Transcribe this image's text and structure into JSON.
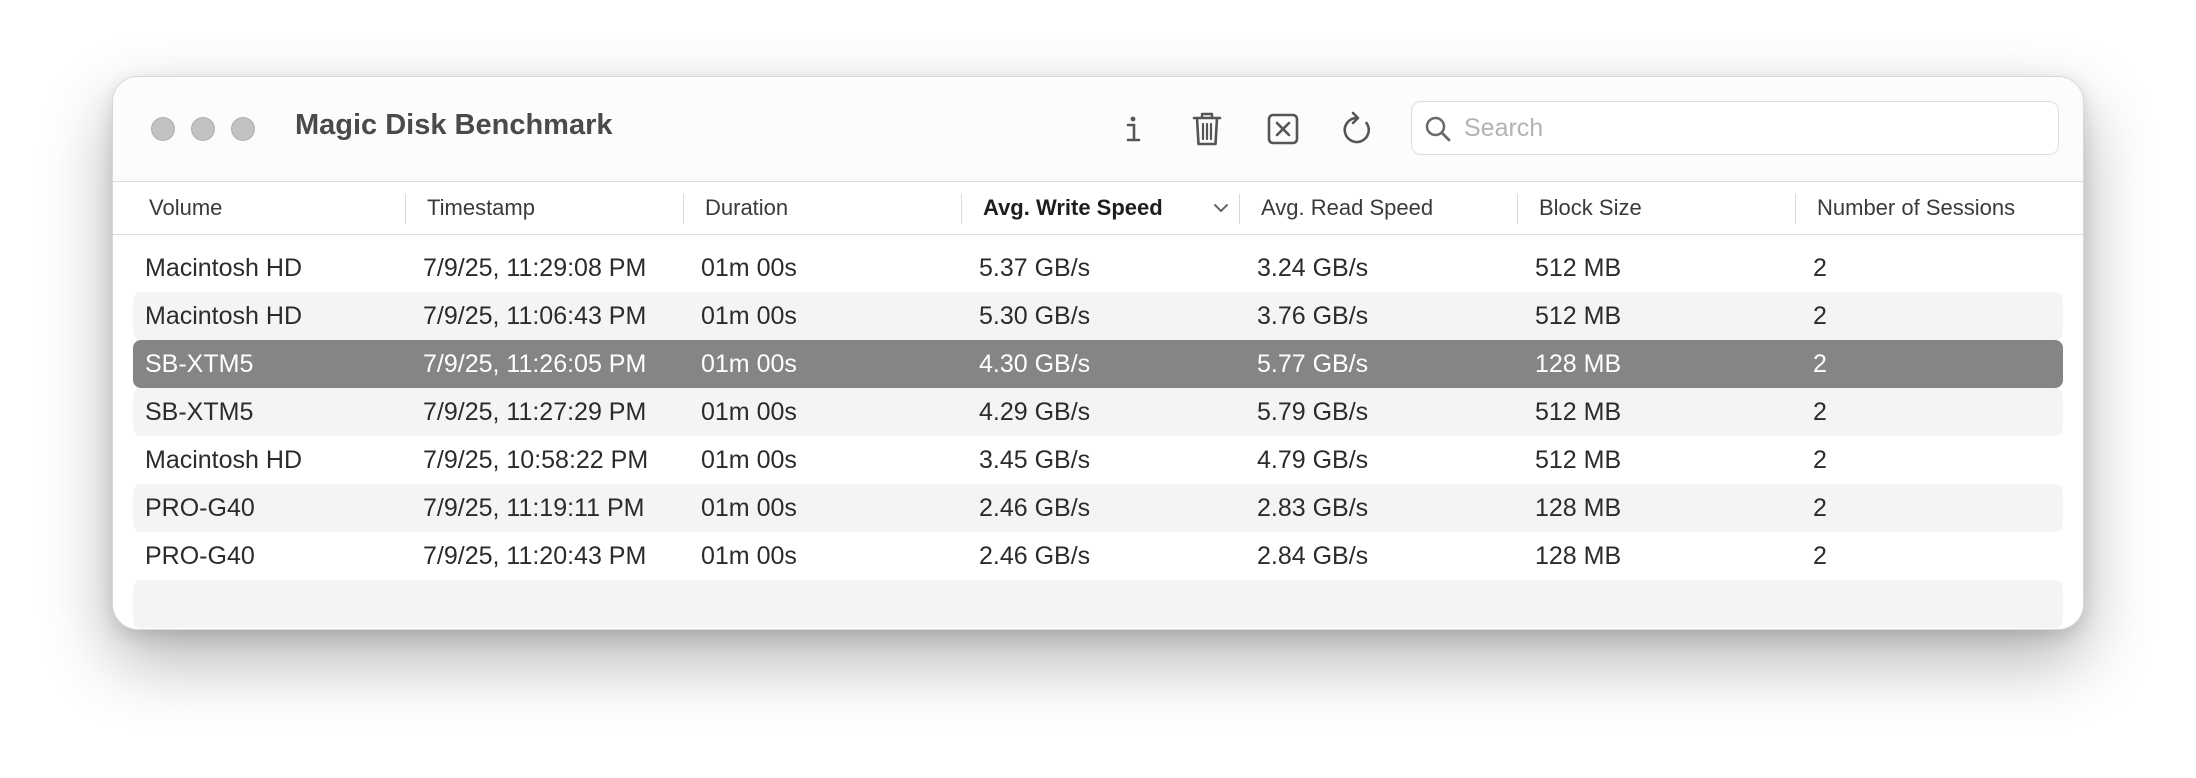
{
  "window": {
    "title": "Magic Disk Benchmark"
  },
  "toolbar": {
    "info_icon": "info-icon",
    "trash_icon": "trash-icon",
    "clear_icon": "x-square-icon",
    "refresh_icon": "refresh-icon"
  },
  "search": {
    "placeholder": "Search",
    "value": ""
  },
  "table": {
    "columns": [
      "Volume",
      "Timestamp",
      "Duration",
      "Avg. Write Speed",
      "Avg. Read Speed",
      "Block Size",
      "Number of Sessions"
    ],
    "sorted_column": "Avg. Write Speed",
    "sort_direction": "descending",
    "rows": [
      [
        "Macintosh HD",
        "7/9/25, 11:29:08 PM",
        "01m 00s",
        "5.37 GB/s",
        "3.24 GB/s",
        "512 MB",
        "2"
      ],
      [
        "Macintosh HD",
        "7/9/25, 11:06:43 PM",
        "01m 00s",
        "5.30 GB/s",
        "3.76 GB/s",
        "512 MB",
        "2"
      ],
      [
        "SB-XTM5",
        "7/9/25, 11:26:05 PM",
        "01m 00s",
        "4.30 GB/s",
        "5.77 GB/s",
        "128 MB",
        "2"
      ],
      [
        "SB-XTM5",
        "7/9/25, 11:27:29 PM",
        "01m 00s",
        "4.29 GB/s",
        "5.79 GB/s",
        "512 MB",
        "2"
      ],
      [
        "Macintosh HD",
        "7/9/25, 10:58:22 PM",
        "01m 00s",
        "3.45 GB/s",
        "4.79 GB/s",
        "512 MB",
        "2"
      ],
      [
        "PRO-G40",
        "7/9/25, 11:19:11 PM",
        "01m 00s",
        "2.46 GB/s",
        "2.83 GB/s",
        "128 MB",
        "2"
      ],
      [
        "PRO-G40",
        "7/9/25, 11:20:43 PM",
        "01m 00s",
        "2.46 GB/s",
        "2.84 GB/s",
        "128 MB",
        "2"
      ]
    ],
    "selected_row": 2
  },
  "colors": {
    "selection": "#858585",
    "alt_row": "#f3f4f4",
    "traffic_light": "#c2c2c2"
  }
}
